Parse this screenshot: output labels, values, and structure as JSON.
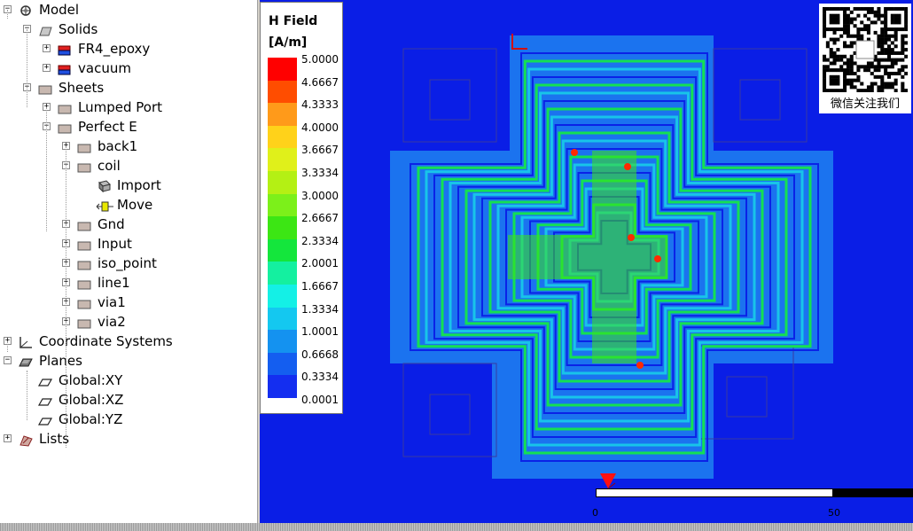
{
  "tree": {
    "items": [
      {
        "label": "Model",
        "icon": "model-icon",
        "exp": "-"
      },
      {
        "label": "Solids",
        "icon": "solids-icon",
        "exp": "-"
      },
      {
        "label": "FR4_epoxy",
        "icon": "material-icon",
        "exp": "+"
      },
      {
        "label": "vacuum",
        "icon": "material-icon",
        "exp": "+"
      },
      {
        "label": "Sheets",
        "icon": "sheets-icon",
        "exp": "-"
      },
      {
        "label": "Lumped Port",
        "icon": "sheet-group-icon",
        "exp": "+"
      },
      {
        "label": "Perfect E",
        "icon": "sheet-group-icon",
        "exp": "-"
      },
      {
        "label": "back1",
        "icon": "sheet-icon",
        "exp": "+"
      },
      {
        "label": "coil",
        "icon": "sheet-icon",
        "exp": "-"
      },
      {
        "label": "Import",
        "icon": "import-icon",
        "exp": ""
      },
      {
        "label": "Move",
        "icon": "move-icon",
        "exp": ""
      },
      {
        "label": "Gnd",
        "icon": "sheet-icon",
        "exp": "+"
      },
      {
        "label": "Input",
        "icon": "sheet-icon",
        "exp": "+"
      },
      {
        "label": "iso_point",
        "icon": "sheet-icon",
        "exp": "+"
      },
      {
        "label": "line1",
        "icon": "sheet-icon",
        "exp": "+"
      },
      {
        "label": "via1",
        "icon": "sheet-icon",
        "exp": "+"
      },
      {
        "label": "via2",
        "icon": "sheet-icon",
        "exp": "+"
      },
      {
        "label": "Coordinate Systems",
        "icon": "coordinate-systems-icon",
        "exp": "+"
      },
      {
        "label": "Planes",
        "icon": "planes-icon",
        "exp": "-"
      },
      {
        "label": "Global:XY",
        "icon": "plane-icon",
        "exp": ""
      },
      {
        "label": "Global:XZ",
        "icon": "plane-icon",
        "exp": ""
      },
      {
        "label": "Global:YZ",
        "icon": "plane-icon",
        "exp": ""
      },
      {
        "label": "Lists",
        "icon": "lists-icon",
        "exp": "+"
      }
    ]
  },
  "legend": {
    "title": "H Field",
    "unit": "[A/m]",
    "ticks": [
      "5.0000",
      "4.6667",
      "4.3333",
      "4.0000",
      "3.6667",
      "3.3334",
      "3.0000",
      "2.6667",
      "2.3334",
      "2.0001",
      "1.6667",
      "1.3334",
      "1.0001",
      "0.6668",
      "0.3334",
      "0.0001"
    ],
    "colors": [
      "#ff0000",
      "#ff4d00",
      "#ff9a1a",
      "#ffd21a",
      "#e0f01a",
      "#b4f014",
      "#7cf01a",
      "#3ce614",
      "#14e63c",
      "#14f0a0",
      "#14f0e6",
      "#14c8f0",
      "#1492f0",
      "#145ef0",
      "#142ef0"
    ]
  },
  "watermark": {
    "caption": "微信关注我们"
  },
  "scale": {
    "left_label": "0",
    "right_label": "50"
  },
  "colors": {
    "background": "#0a1ee6",
    "trace": "#14e64a",
    "hotspot": "#ff2a00"
  }
}
